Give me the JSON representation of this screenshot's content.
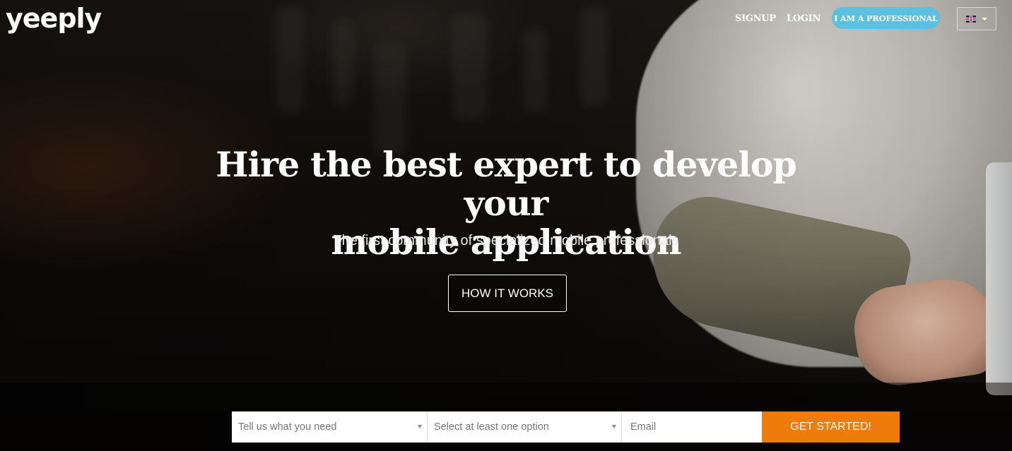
{
  "header": {
    "logo": "yeeply",
    "nav": {
      "signup_label": "SIGNUP",
      "login_label": "LOGIN",
      "professional_label": "I AM A PROFESSIONAL"
    },
    "language": {
      "flag_icon": "uk-flag-icon"
    }
  },
  "hero": {
    "title_line1": "Hire the best expert to develop your",
    "title_line2": "mobile application",
    "subtitle": "The first community of specialized mobile professionals",
    "cta_label": "HOW IT WORKS"
  },
  "form": {
    "need_select": "Tell us what you need",
    "option_select": "Select at least one option",
    "email_placeholder": "Email",
    "submit_label": "GET STARTED!"
  },
  "colors": {
    "accent_blue": "#5cc1e0",
    "cta_orange": "#ef7b0a"
  }
}
